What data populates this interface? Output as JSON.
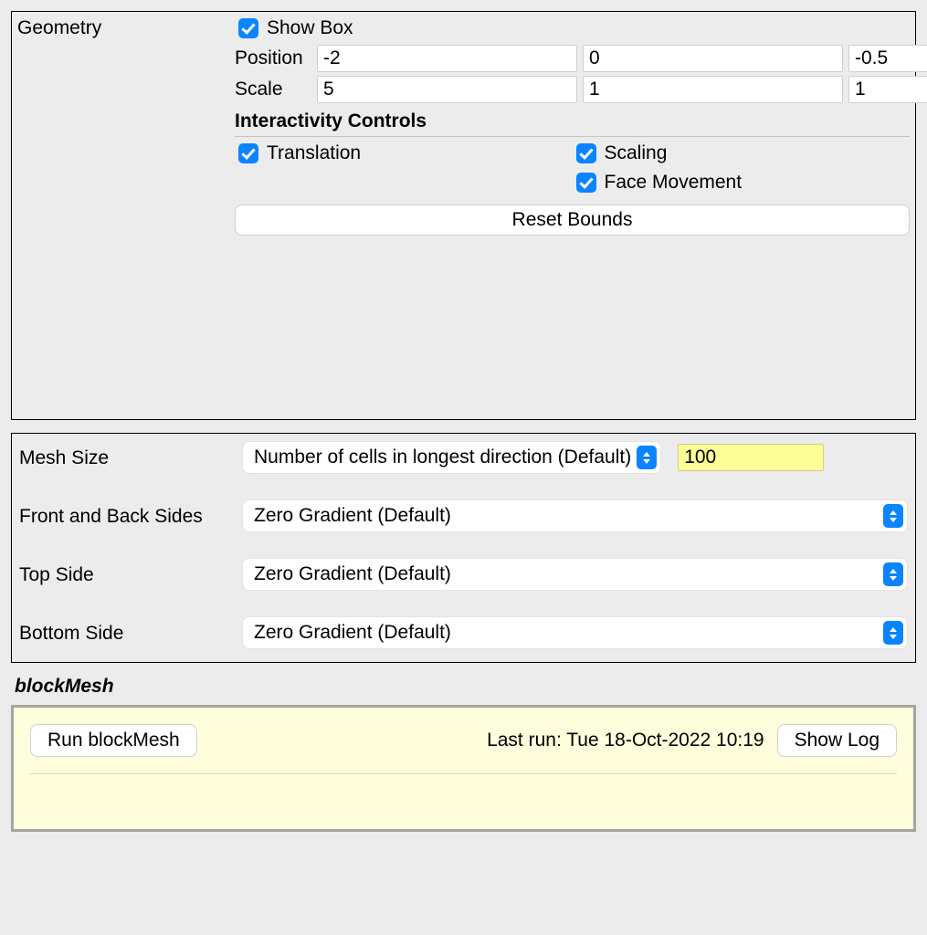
{
  "geometry": {
    "section_label": "Geometry",
    "show_box_label": "Show Box",
    "position_label": "Position",
    "position": [
      "-2",
      "0",
      "-0.5"
    ],
    "scale_label": "Scale",
    "scale": [
      "5",
      "1",
      "1"
    ],
    "interactivity_heading": "Interactivity Controls",
    "translation_label": "Translation",
    "scaling_label": "Scaling",
    "face_movement_label": "Face Movement",
    "reset_bounds_label": "Reset Bounds"
  },
  "mesh": {
    "mesh_size_label": "Mesh Size",
    "mesh_size_option": "Number of cells in longest direction (Default)",
    "mesh_size_value": "100",
    "front_back_label": "Front and Back Sides",
    "front_back_option": "Zero Gradient (Default)",
    "top_label": "Top Side",
    "top_option": "Zero Gradient (Default)",
    "bottom_label": "Bottom Side",
    "bottom_option": "Zero Gradient (Default)"
  },
  "run": {
    "section_title": "blockMesh",
    "run_button": "Run blockMesh",
    "status_text": "Last run: Tue 18-Oct-2022 10:19",
    "show_log_button": "Show Log"
  }
}
